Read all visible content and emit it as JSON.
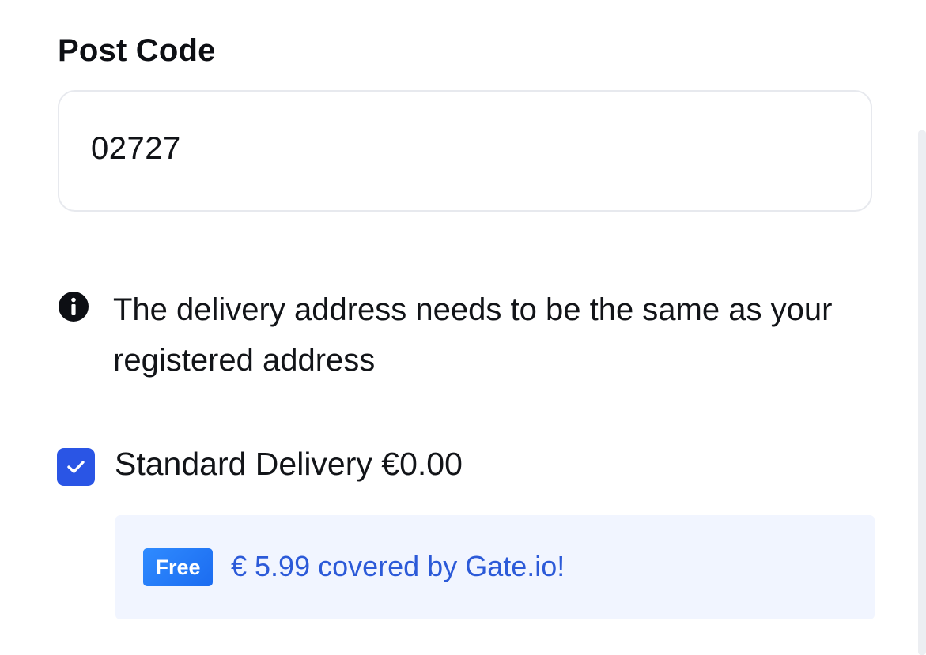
{
  "post_code": {
    "label": "Post Code",
    "value": "02727"
  },
  "info": {
    "icon": "info-icon",
    "text": "The delivery address needs to be the same as your registered address"
  },
  "delivery": {
    "checked": true,
    "label": "Standard Delivery €0.00"
  },
  "promo": {
    "badge": "Free",
    "text": "€ 5.99 covered by Gate.io!"
  },
  "colors": {
    "accent": "#2a55e5",
    "promo_text": "#2c5ad8",
    "promo_bg": "#f1f5ff",
    "badge": "#1c6cf0"
  }
}
